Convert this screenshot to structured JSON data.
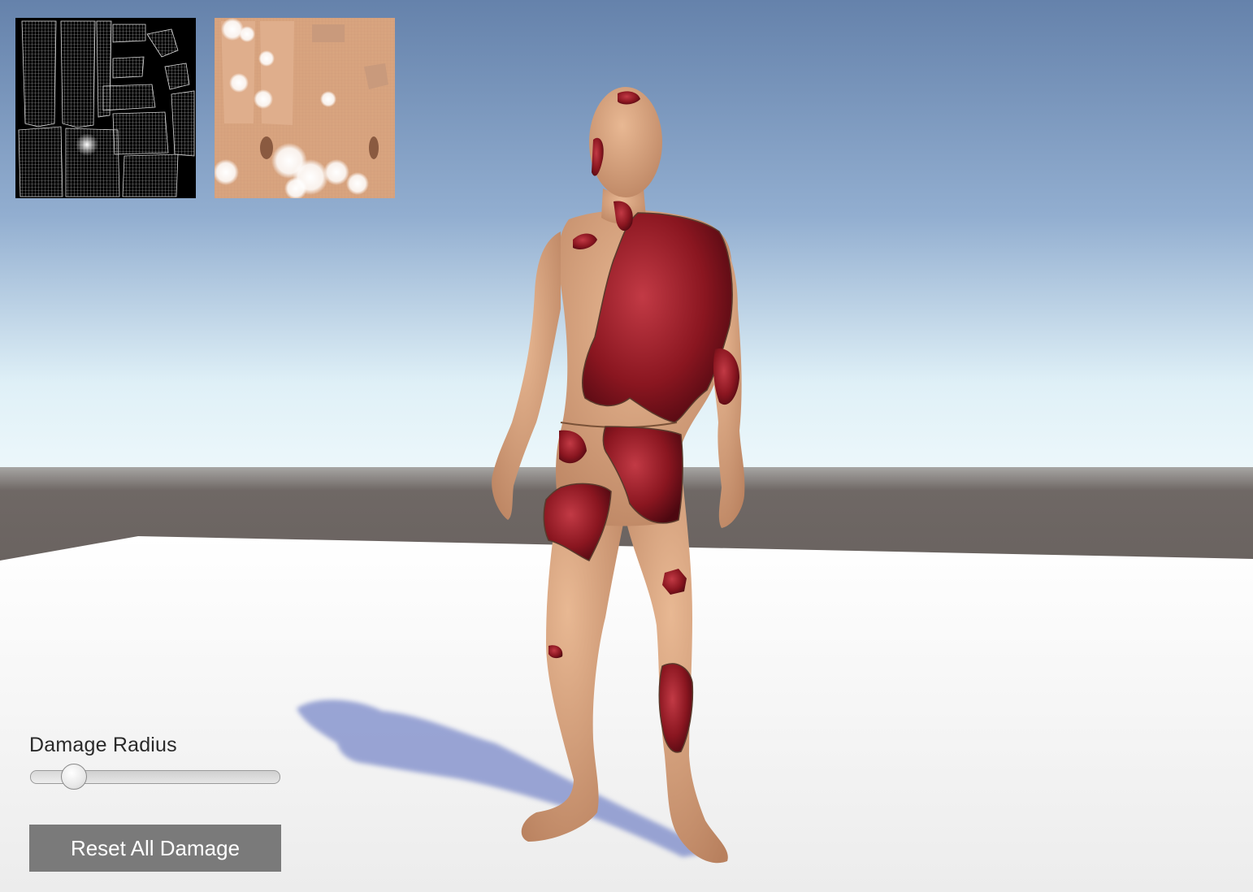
{
  "hud": {
    "damage_radius": {
      "label": "Damage Radius",
      "value_fraction": 0.14
    },
    "reset_button": {
      "label": "Reset All Damage"
    }
  },
  "previews": {
    "uv_mask": {
      "icon": "uv-wireframe-damage-mask",
      "background": "#000000"
    },
    "skin_texture": {
      "icon": "skin-texture-with-damage",
      "background": "#d8a47f"
    }
  },
  "scene": {
    "sky_top": "#6a86ad",
    "horizon": "#eef7fb",
    "ground_far": "#6b6461",
    "floor": "#f3f3f3",
    "skin": "#d59f7b",
    "wound": "#8c1620"
  }
}
